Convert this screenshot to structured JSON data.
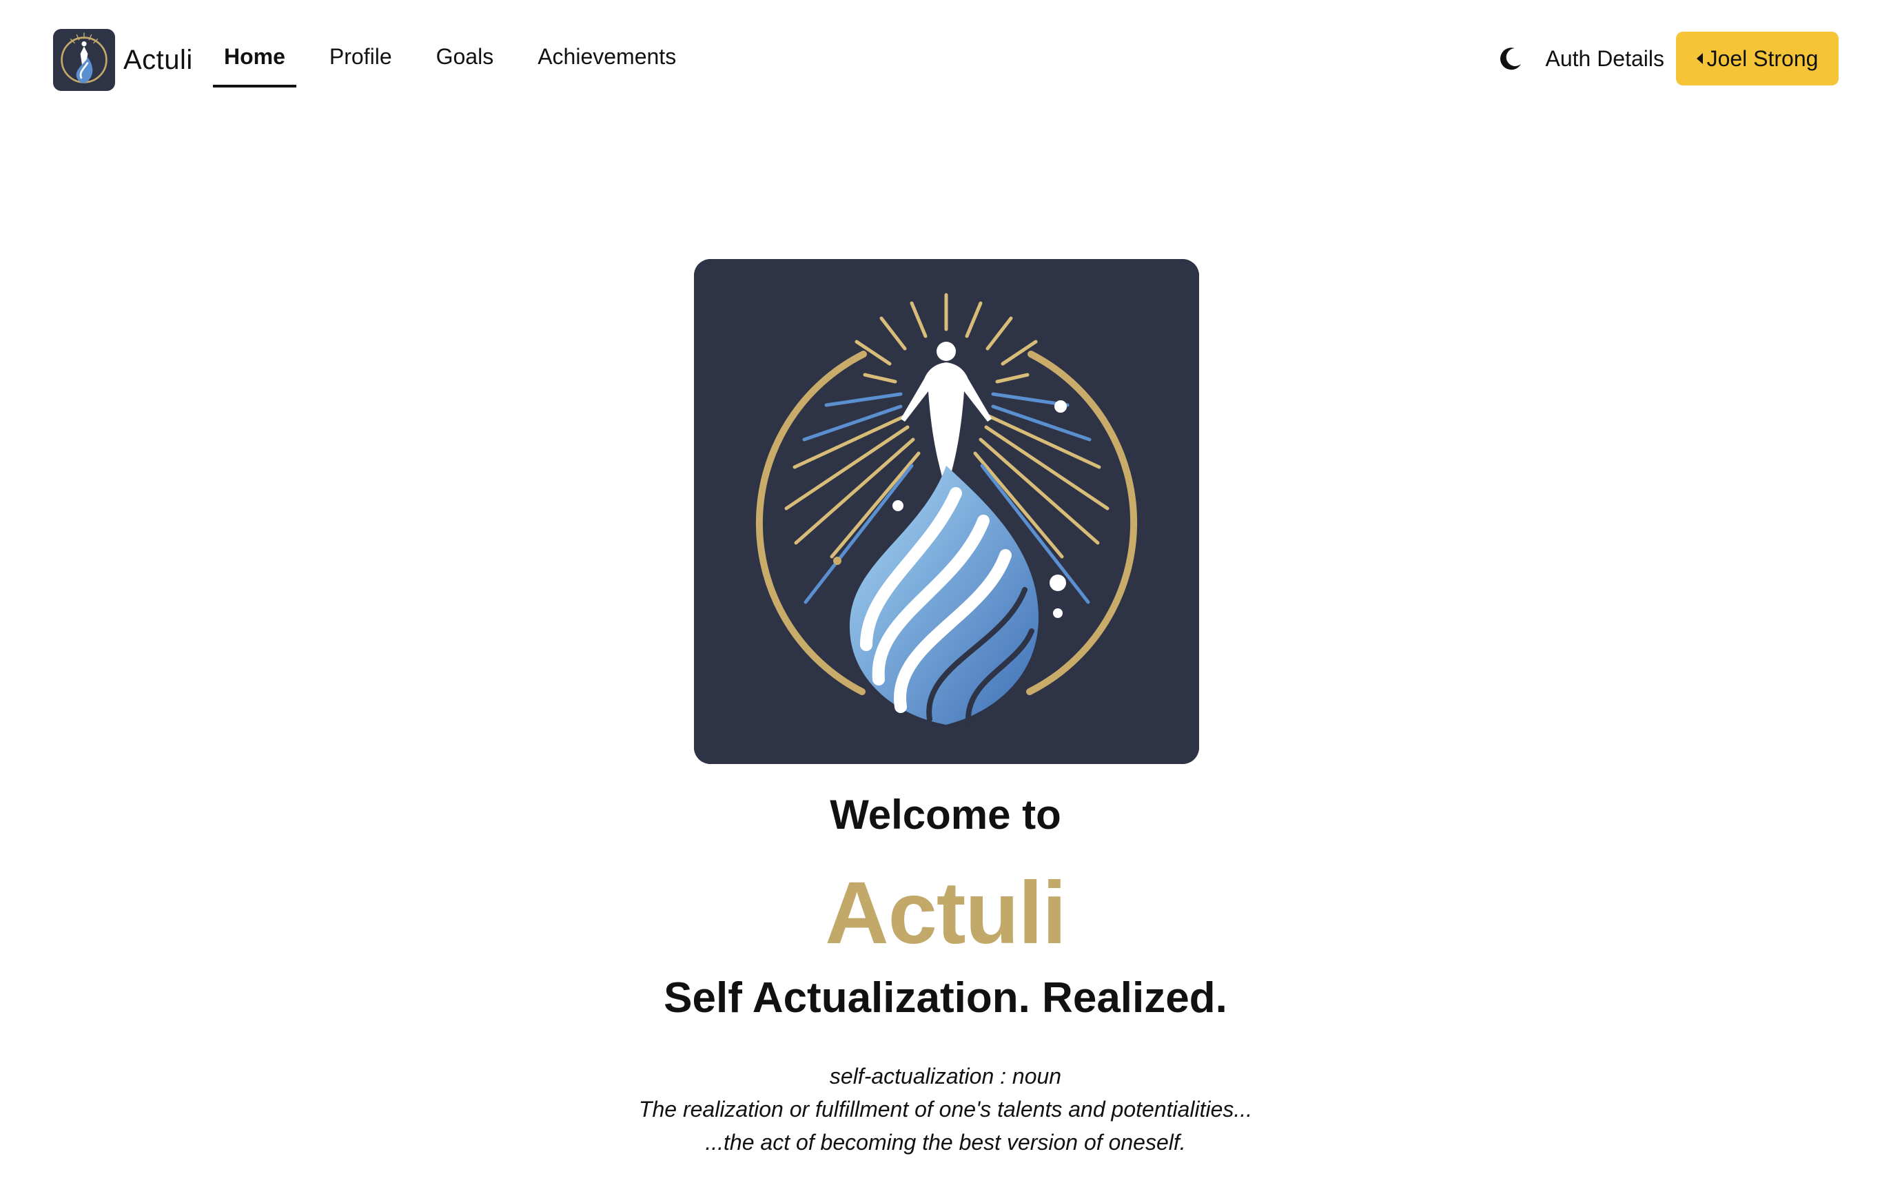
{
  "nav": {
    "brand": "Actuli",
    "links": [
      "Home",
      "Profile",
      "Goals",
      "Achievements"
    ],
    "auth_details": "Auth Details",
    "user_name": "Joel Strong"
  },
  "icons": {
    "theme_toggle": "moon-icon",
    "user_menu": "caret-left-icon"
  },
  "hero": {
    "welcome": "Welcome to",
    "app_name": "Actuli",
    "tagline": "Self Actualization. Realized.",
    "definition_line1": "self-actualization : noun",
    "definition_line2": "The realization or fulfillment of one's talents and potentialities...",
    "definition_line3": "...the act of becoming the best version of oneself."
  },
  "colors": {
    "accent_gold": "#c2a96a",
    "button_yellow": "#f6c537",
    "logo_background": "#2f3346",
    "wave_blue": "#5a8fd0"
  }
}
